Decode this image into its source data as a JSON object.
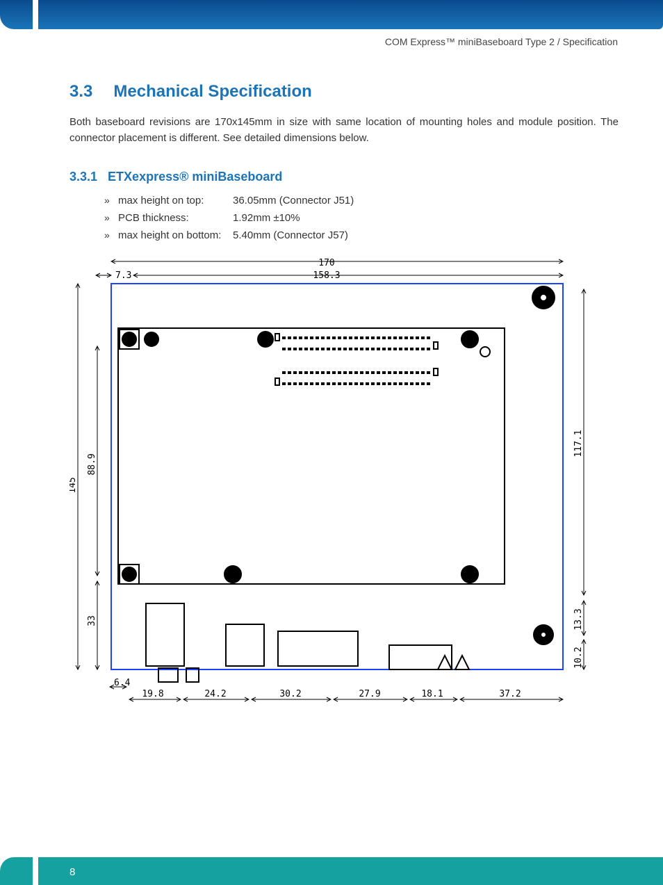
{
  "header": {
    "breadcrumb": "COM Express™ miniBaseboard Type 2 / Specification"
  },
  "section": {
    "number": "3.3",
    "title": "Mechanical Specification",
    "paragraph": "Both baseboard revisions are 170x145mm in size with same location of mounting holes and module position. The connector placement is different. See detailed dimensions below."
  },
  "subsection": {
    "number": "3.3.1",
    "title": "ETXexpress® miniBaseboard",
    "bullet": "»",
    "specs": [
      {
        "label": "max height on top:",
        "value": "36.05mm (Connector J51)"
      },
      {
        "label": "PCB thickness:",
        "value": "1.92mm ±10%"
      },
      {
        "label": "max height on bottom:",
        "value": "5.40mm (Connector J57)"
      }
    ]
  },
  "drawing": {
    "dims_top": {
      "overall": "170",
      "inner": "158.3",
      "left_offset": "7.3"
    },
    "dims_left": {
      "overall": "145",
      "inner": "88.9",
      "lower": "33"
    },
    "dims_right": {
      "upper": "117.1",
      "mid": "13.3",
      "lower": "10.2"
    },
    "dims_bottom": {
      "a": "6.4",
      "b": "19.8",
      "c": "24.2",
      "d": "30.2",
      "e": "27.9",
      "f": "18.1",
      "g": "37.2"
    }
  },
  "footer": {
    "page": "8"
  }
}
